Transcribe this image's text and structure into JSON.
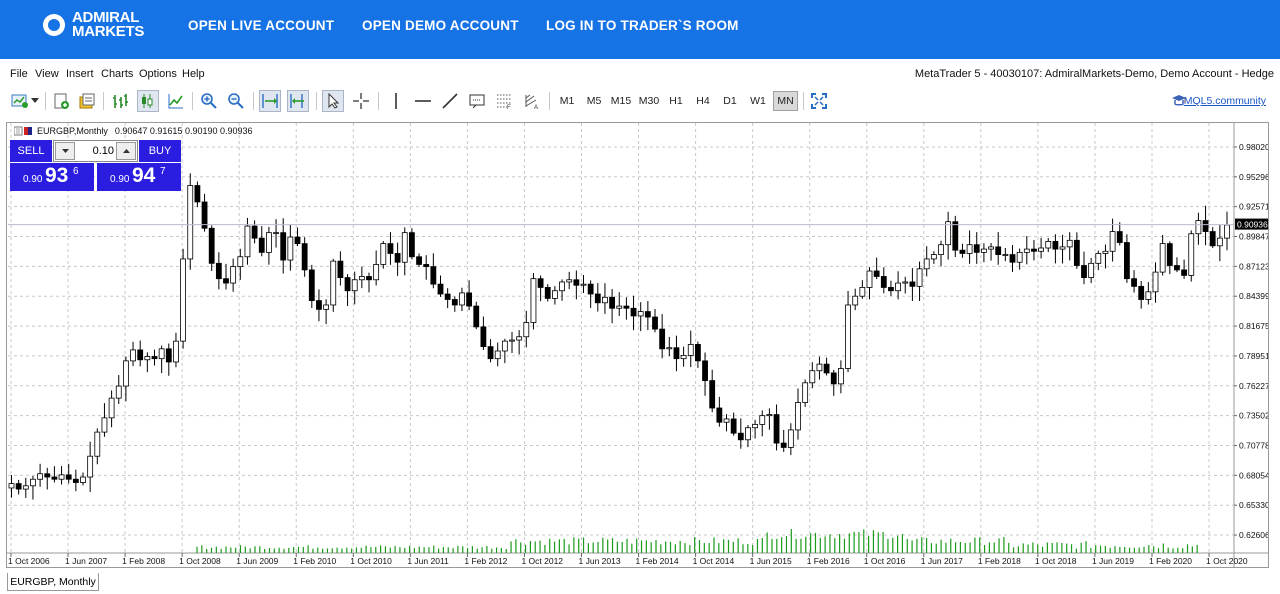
{
  "banner": {
    "logo_line1": "ADMIRAL",
    "logo_line2": "MARKETS",
    "nav": [
      "OPEN LIVE ACCOUNT",
      "OPEN DEMO ACCOUNT",
      "LOG IN TO TRADER`S ROOM"
    ],
    "bg_color": "#1673e6"
  },
  "menu": {
    "items": [
      "File",
      "View",
      "Insert",
      "Charts",
      "Options",
      "Help"
    ],
    "window_title": "MetaTrader 5 - 40030107: AdmiralMarkets-Demo, Demo Account - Hedge"
  },
  "toolbar": {
    "icons": [
      "new-chart-icon",
      "dropdown-arrow-icon",
      "new-order-icon",
      "market-depth-icon",
      "bar-chart-icon",
      "candlestick-icon",
      "line-chart-icon",
      "zoom-in-icon",
      "zoom-out-icon",
      "autoscroll-icon",
      "chart-shift-icon",
      "cursor-icon",
      "crosshair-icon",
      "vertical-line-icon",
      "horizontal-line-icon",
      "trendline-icon",
      "text-label-icon",
      "fibonacci-icon",
      "objects-icon",
      "fullscreen-icon"
    ],
    "timeframes": [
      "M1",
      "M5",
      "M15",
      "M30",
      "H1",
      "H4",
      "D1",
      "W1",
      "MN"
    ],
    "active_timeframe": "MN",
    "community_link": "MQL5.community"
  },
  "chart_header": {
    "symbol": "EURGBP,Monthly",
    "ohlc": "0.90647 0.91615 0.90190 0.90936"
  },
  "trade_panel": {
    "sell_label": "SELL",
    "buy_label": "BUY",
    "lot_value": "0.10",
    "sell_price_prefix": "0.90",
    "sell_price_big": "93",
    "sell_price_sup": "6",
    "buy_price_prefix": "0.90",
    "buy_price_big": "94",
    "buy_price_sup": "7",
    "panel_color": "#2b1de0"
  },
  "chart_data": {
    "type": "candlestick",
    "symbol": "EURGBP",
    "timeframe": "Monthly",
    "current_price": "0.90936",
    "y_ticks": [
      "0.98020",
      "0.95296",
      "0.92571",
      "0.89847",
      "0.87123",
      "0.84399",
      "0.81675",
      "0.78951",
      "0.76227",
      "0.73502",
      "0.70778",
      "0.68054",
      "0.65330",
      "0.62606"
    ],
    "ylim": [
      0.60968,
      0.99658
    ],
    "x_ticks": [
      "1 Oct 2006",
      "1 Jun 2007",
      "1 Feb 2008",
      "1 Oct 2008",
      "1 Jun 2009",
      "1 Feb 2010",
      "1 Oct 2010",
      "1 Jun 2011",
      "1 Feb 2012",
      "1 Oct 2012",
      "1 Jun 2013",
      "1 Feb 2014",
      "1 Oct 2014",
      "1 Jun 2015",
      "1 Feb 2016",
      "1 Oct 2016",
      "1 Jun 2017",
      "1 Feb 2018",
      "1 Oct 2018",
      "1 Jun 2019",
      "1 Feb 2020",
      "1 Oct 2020"
    ],
    "close_path": [
      0.673,
      0.668,
      0.671,
      0.677,
      0.682,
      0.679,
      0.677,
      0.681,
      0.677,
      0.674,
      0.679,
      0.698,
      0.72,
      0.733,
      0.751,
      0.762,
      0.785,
      0.795,
      0.786,
      0.789,
      0.787,
      0.796,
      0.784,
      0.803,
      0.878,
      0.945,
      0.93,
      0.906,
      0.874,
      0.86,
      0.856,
      0.871,
      0.88,
      0.908,
      0.897,
      0.884,
      0.902,
      0.902,
      0.877,
      0.898,
      0.892,
      0.868,
      0.84,
      0.832,
      0.836,
      0.876,
      0.861,
      0.849,
      0.859,
      0.862,
      0.859,
      0.873,
      0.892,
      0.883,
      0.875,
      0.902,
      0.88,
      0.873,
      0.871,
      0.855,
      0.846,
      0.841,
      0.836,
      0.847,
      0.835,
      0.816,
      0.798,
      0.787,
      0.794,
      0.803,
      0.804,
      0.807,
      0.82,
      0.86,
      0.852,
      0.842,
      0.849,
      0.857,
      0.859,
      0.854,
      0.855,
      0.846,
      0.838,
      0.843,
      0.833,
      0.835,
      0.833,
      0.826,
      0.83,
      0.825,
      0.814,
      0.796,
      0.797,
      0.787,
      0.79,
      0.8,
      0.785,
      0.767,
      0.742,
      0.729,
      0.732,
      0.719,
      0.713,
      0.724,
      0.727,
      0.735,
      0.736,
      0.71,
      0.706,
      0.722,
      0.747,
      0.765,
      0.776,
      0.782,
      0.774,
      0.764,
      0.778,
      0.836,
      0.844,
      0.852,
      0.867,
      0.862,
      0.852,
      0.849,
      0.856,
      0.857,
      0.853,
      0.869,
      0.878,
      0.882,
      0.891,
      0.912,
      0.886,
      0.883,
      0.891,
      0.884,
      0.887,
      0.889,
      0.882,
      0.882,
      0.875,
      0.884,
      0.887,
      0.885,
      0.888,
      0.894,
      0.887,
      0.889,
      0.895,
      0.872,
      0.861,
      0.874,
      0.883,
      0.885,
      0.903,
      0.893,
      0.86,
      0.853,
      0.841,
      0.848,
      0.866,
      0.892,
      0.872,
      0.868,
      0.863,
      0.901,
      0.913,
      0.903,
      0.89,
      0.897,
      0.909
    ],
    "volume_bars": 208,
    "bull_color": "#ffffff",
    "bear_color": "#000000",
    "volume_color": "#1a9b1a"
  },
  "bottom_tab": "EURGBP, Monthly"
}
